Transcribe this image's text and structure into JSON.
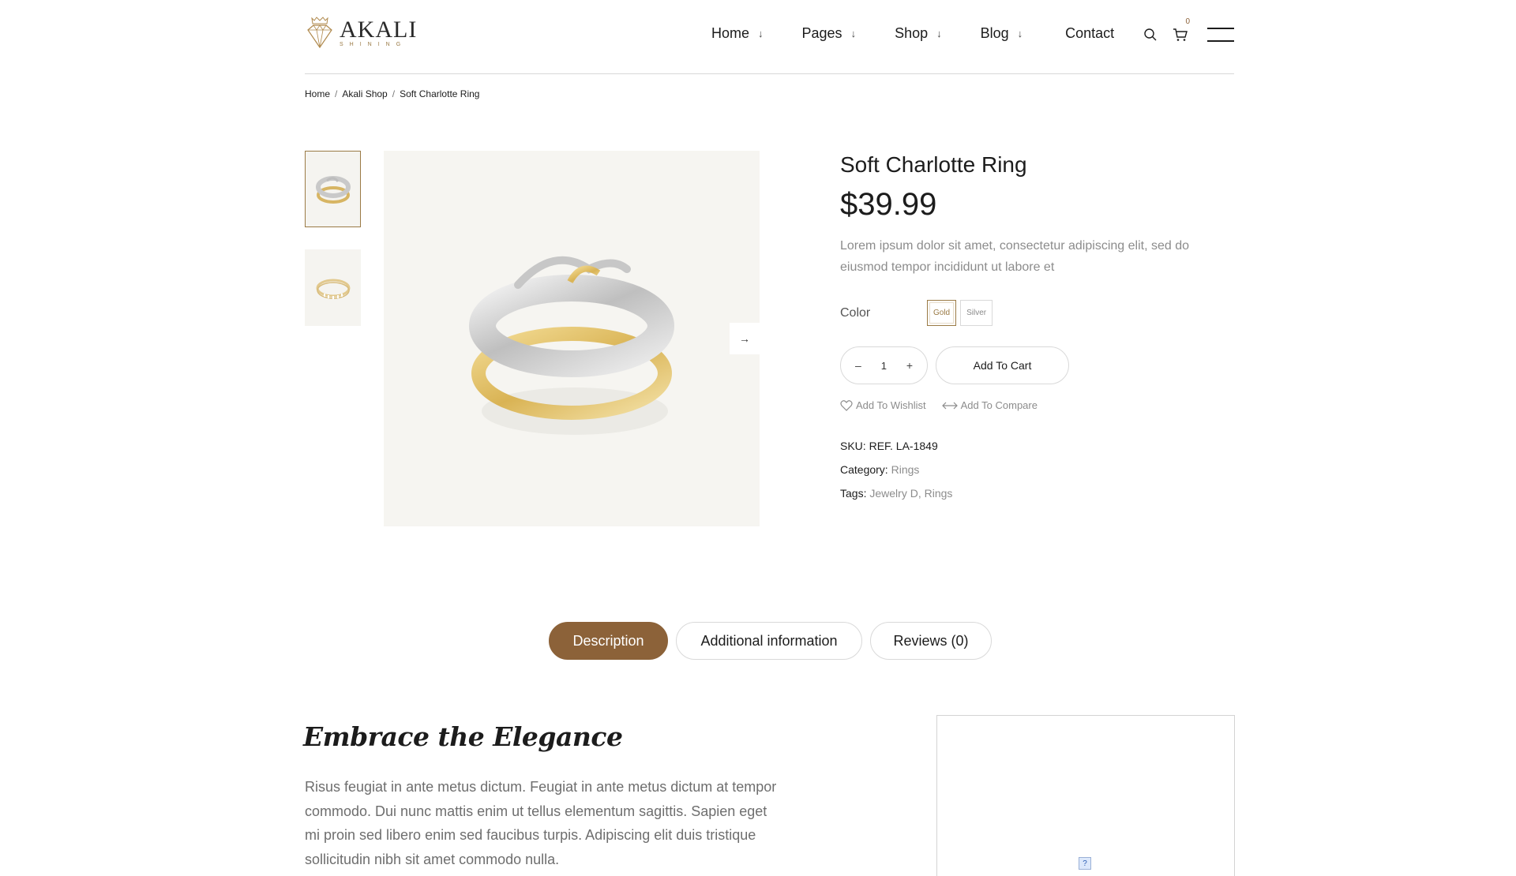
{
  "header": {
    "logo": {
      "word": "AKALI",
      "sub": "SHINING"
    },
    "nav": [
      {
        "label": "Home"
      },
      {
        "label": "Pages"
      },
      {
        "label": "Shop"
      },
      {
        "label": "Blog"
      },
      {
        "label": "Contact"
      }
    ],
    "cart_count": "0",
    "icons": [
      "search-icon",
      "cart-icon",
      "menu-icon"
    ]
  },
  "breadcrumb": {
    "items": [
      "Home",
      "Akali Shop",
      "Soft Charlotte Ring"
    ],
    "separator": "/"
  },
  "gallery": {
    "thumbnails": [
      "ring-two-tone",
      "ring-gold-band"
    ],
    "selected": 0
  },
  "product": {
    "title": "Soft Charlotte Ring",
    "price": "$39.99",
    "short_description": "Lorem ipsum dolor sit amet, consectetur adipiscing elit, sed do eiusmod tempor incididunt ut labore et",
    "color_label": "Color",
    "colors": [
      "Gold",
      "Silver"
    ],
    "selected_color": "Gold",
    "qty_minus": "–",
    "quantity": "1",
    "qty_plus": "+",
    "add_to_cart": "Add To Cart",
    "wishlist": "Add To Wishlist",
    "compare": "Add To Compare",
    "sku_label": "SKU:",
    "sku": "REF. LA-1849",
    "category_label": "Category:",
    "category": "Rings",
    "tags_label": "Tags:",
    "tags": "Jewelry D, Rings"
  },
  "tabs": [
    {
      "label": "Description",
      "active": true
    },
    {
      "label": "Additional information",
      "active": false
    },
    {
      "label": "Reviews (0)",
      "active": false
    }
  ],
  "description": {
    "heading": "Embrace the Elegance",
    "body": "Risus feugiat in ante metus dictum. Feugiat in ante metus dictum at tempor commodo. Dui nunc mattis enim ut tellus elementum sagittis. Sapien eget mi proin sed libero enim sed faucibus turpis. Adipiscing elit duis tristique sollicitudin nibh sit amet commodo nulla."
  },
  "colors": {
    "accent": "#8c6239",
    "text": "#1c1c1c",
    "muted": "#8c8c8c",
    "image_bg": "#f6f5f1"
  }
}
